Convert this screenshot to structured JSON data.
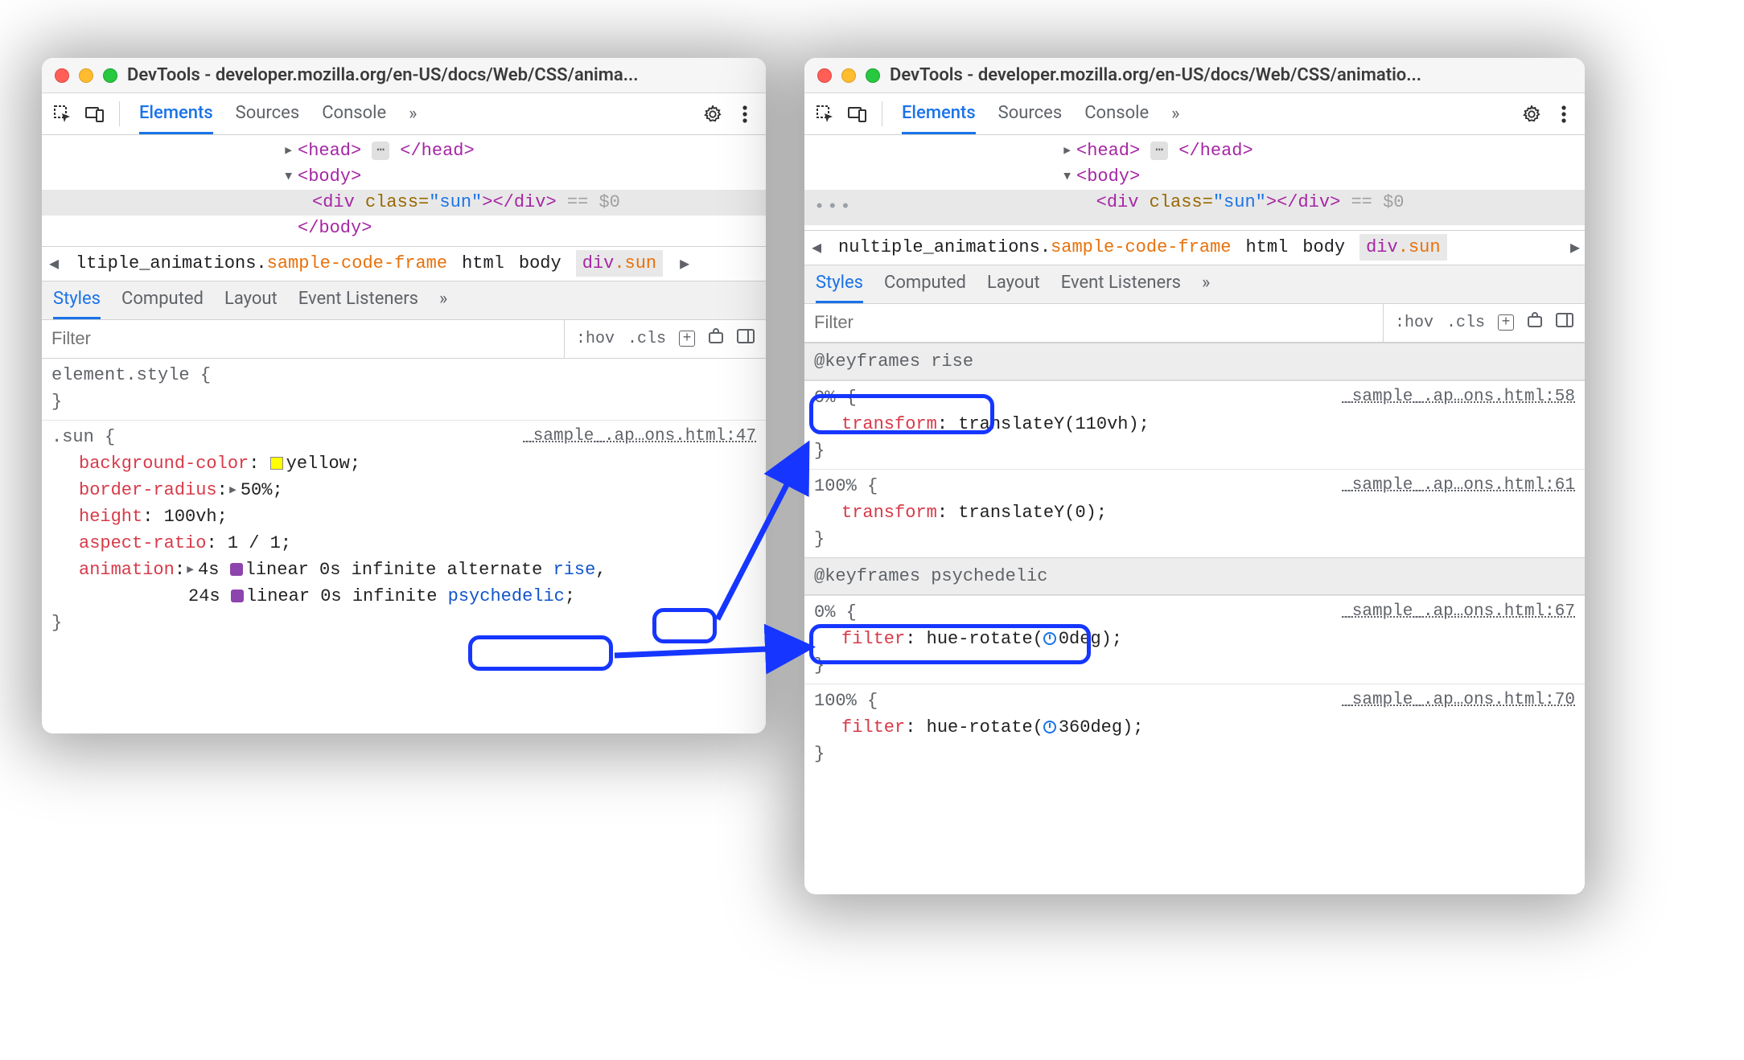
{
  "title": "DevTools - developer.mozilla.org/en-US/docs/Web/CSS/anima...",
  "title_right": "DevTools - developer.mozilla.org/en-US/docs/Web/CSS/animatio...",
  "toolbar": {
    "tabs": {
      "elements": "Elements",
      "sources": "Sources",
      "console": "Console"
    },
    "more": "»"
  },
  "elements_tree": {
    "head_open": "<head>",
    "head_close": "</head>",
    "body_open": "<body>",
    "body_close": "</body>",
    "div_open_tag": "div",
    "div_class_attr": "class",
    "div_class_val": "\"sun\"",
    "div_close": "</div>",
    "eqsel": "== $0"
  },
  "crumb": {
    "frame_prefix_a": "ltiple_animations.",
    "frame_prefix_b": "nultiple_animations.",
    "frame_suffix": "sample-code-frame",
    "html": "html",
    "body": "body",
    "divsun": "div.sun"
  },
  "subtabs": {
    "styles": "Styles",
    "computed": "Computed",
    "layout": "Layout",
    "listeners": "Event Listeners",
    "more": "»"
  },
  "filter": {
    "placeholder": "Filter",
    "hov": ":hov",
    "cls": ".cls",
    "plus": "+"
  },
  "left_styles": {
    "element_style": "element.style {",
    "close": "}",
    "sun_selector": ".sun {",
    "origin": "_sample_.ap…ons.html:47",
    "props": {
      "bgc_k": "background-color",
      "bgc_v": "yellow",
      "br_k": "border-radius",
      "br_v": "50%",
      "h_k": "height",
      "h_v": "100vh",
      "ar_k": "aspect-ratio",
      "ar_v": "1 / 1",
      "anim_k": "animation",
      "anim_v1_pre": "4s ",
      "anim_v1_mid": "linear 0s infinite alternate ",
      "anim_v1_name": "rise",
      "anim_v2_pre": "24s ",
      "anim_v2_mid": "linear 0s infinite ",
      "anim_v2_name": "psychedelic"
    }
  },
  "right_styles": {
    "kf_rise_header": "@keyframes rise",
    "kf_psy_header": "@keyframes psychedelic",
    "rise": {
      "origin0": "_sample_.ap…ons.html:58",
      "origin100": "_sample_.ap…ons.html:61",
      "p0_sel": "0% {",
      "p0_k": "transform",
      "p0_v": "translateY(110vh)",
      "p100_sel": "100% {",
      "p100_k": "transform",
      "p100_v": "translateY(0)"
    },
    "psy": {
      "origin0": "_sample_.ap…ons.html:67",
      "origin100": "_sample_.ap…ons.html:70",
      "p0_sel": "0% {",
      "p0_k": "filter",
      "p0_v": "hue-rotate(",
      "p0_v2": "0deg)",
      "p100_sel": "100% {",
      "p100_k": "filter",
      "p100_v": "hue-rotate(",
      "p100_v2": "360deg)"
    },
    "close": "}"
  }
}
